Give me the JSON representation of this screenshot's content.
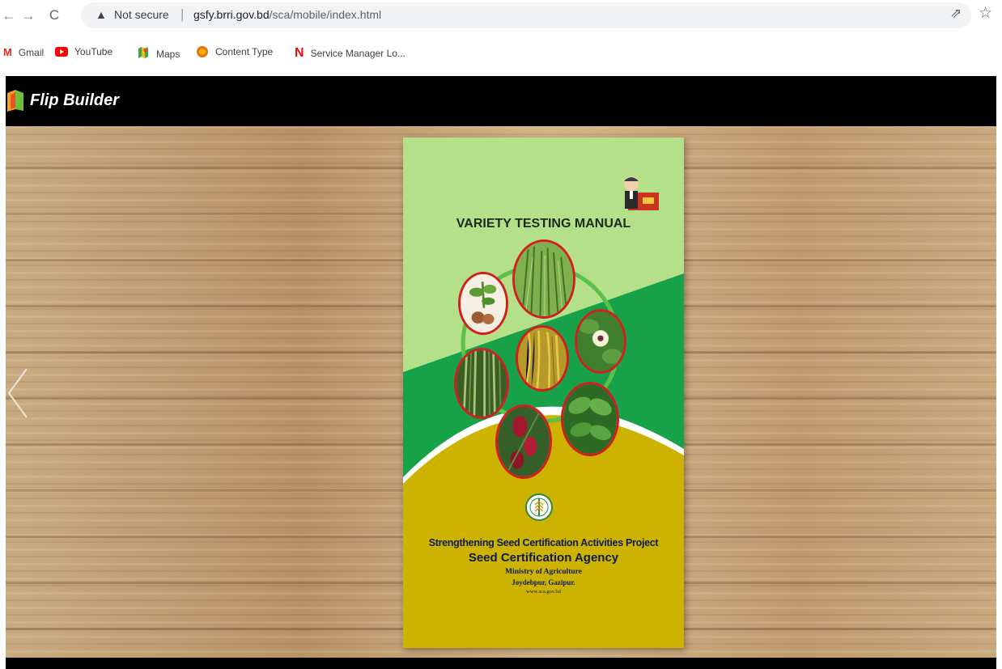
{
  "browser": {
    "security_label": "Not secure",
    "separator": "|",
    "url_host": "gsfy.brri.gov.bd",
    "url_path": "/sca/mobile/index.html",
    "nav_icons": [
      "back-arrow-icon",
      "forward-arrow-icon",
      "reload-icon",
      "warning-icon",
      "share-icon",
      "star-icon"
    ]
  },
  "bookmarks": [
    {
      "label": "Gmail",
      "icon": "gmail-icon"
    },
    {
      "label": "YouTube",
      "icon": "youtube-icon"
    },
    {
      "label": "Maps",
      "icon": "maps-icon"
    },
    {
      "label": "Content Type",
      "icon": "content-type-icon"
    },
    {
      "label": "Service Manager Lo...",
      "icon": "netflix-n-icon"
    }
  ],
  "viewer": {
    "brand": "Flip Builder",
    "header_color": "#000000",
    "prev_icon": "chevron-left-icon"
  },
  "book": {
    "title": "VARIETY TESTING MANUAL",
    "project": "Strengthening Seed Certification Activities Project",
    "agency": "Seed Certification Agency",
    "ministry": "Ministry of Agriculture",
    "place": "Joydebpur, Gazipur.",
    "website": "www.sca.gov.bd",
    "colors": {
      "light_green": "#b5e08a",
      "dark_green": "#17a24a",
      "yellow": "#cdb300",
      "ring": "#d11f1f"
    }
  }
}
